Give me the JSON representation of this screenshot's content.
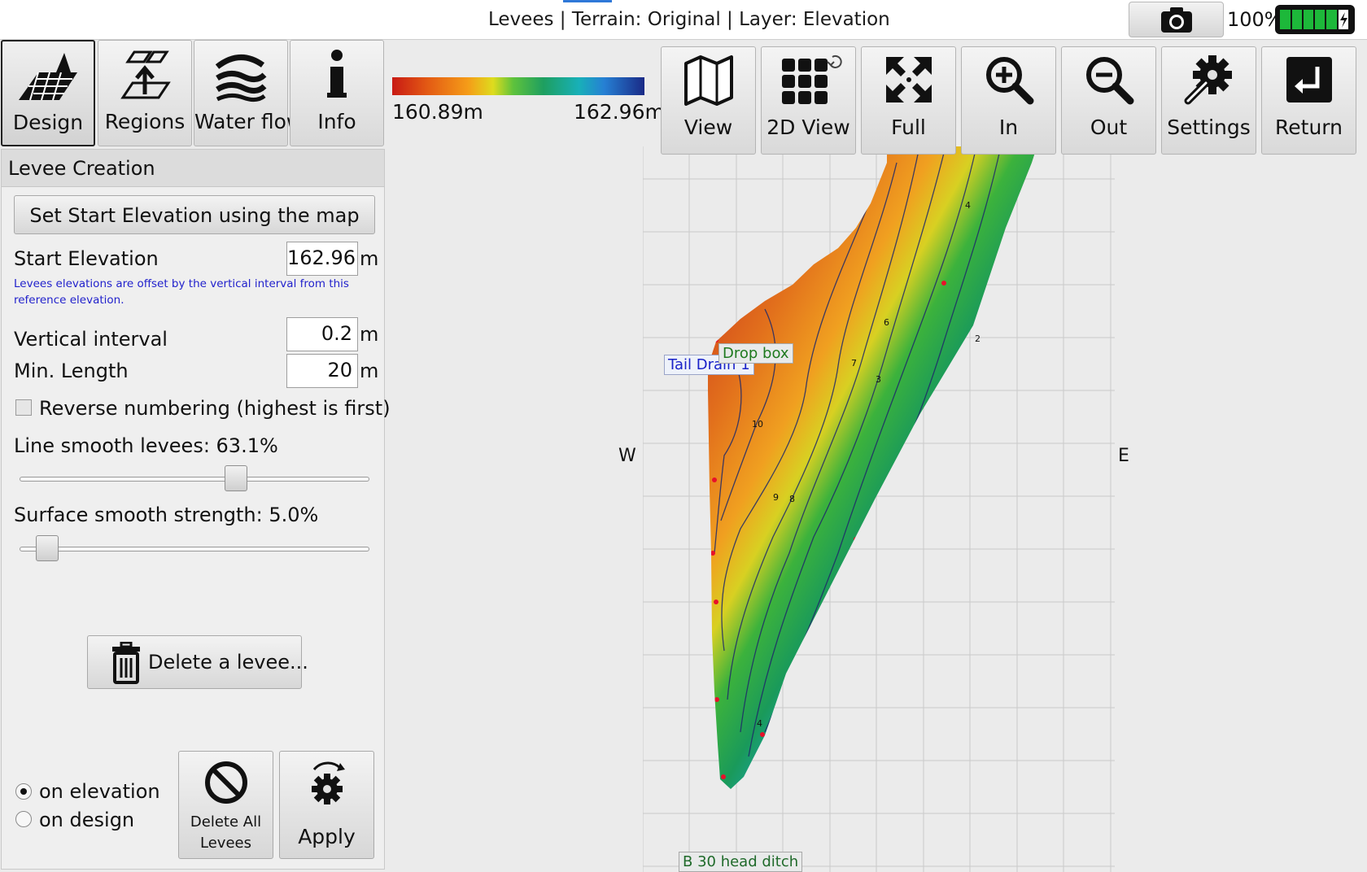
{
  "title_bar": {
    "title": "Levees | Terrain: Original | Layer: Elevation",
    "battery_percent": "100%"
  },
  "nav_tabs": [
    {
      "label": "Design",
      "icon": "field-design-icon",
      "active": true
    },
    {
      "label": "Regions",
      "icon": "regions-icon",
      "active": false
    },
    {
      "label": "Water flow",
      "icon": "water-flow-icon",
      "active": false
    },
    {
      "label": "Info",
      "icon": "info-icon",
      "active": false
    }
  ],
  "toolbar": [
    {
      "label": "View",
      "icon": "map-icon"
    },
    {
      "label": "2D View",
      "icon": "grid-2d-icon"
    },
    {
      "label": "Full",
      "icon": "full-extent-icon"
    },
    {
      "label": "In",
      "icon": "zoom-in-icon"
    },
    {
      "label": "Out",
      "icon": "zoom-out-icon"
    },
    {
      "label": "Settings",
      "icon": "settings-icon"
    },
    {
      "label": "Return",
      "icon": "return-icon"
    }
  ],
  "color_scale": {
    "min_label": "160.89m",
    "max_label": "162.96m"
  },
  "panel": {
    "title": "Levee Creation",
    "set_start_button": "Set Start Elevation using the map",
    "start_elevation_label": "Start Elevation",
    "start_elevation_value": "162.96",
    "unit": "m",
    "note": "Levees elevations are offset by the vertical interval from this reference elevation.",
    "vertical_interval_label": "Vertical interval",
    "vertical_interval_value": "0.2",
    "min_length_label": "Min. Length",
    "min_length_value": "20",
    "reverse_label": "Reverse numbering (highest is first)",
    "reverse_checked": false,
    "line_smooth_label": "Line smooth levees: 63.1%",
    "line_smooth_value": 0.631,
    "surface_smooth_label": "Surface smooth strength: 5.0%",
    "surface_smooth_value": 0.05,
    "delete_levee_button": "Delete a levee...",
    "radio_options": [
      "on elevation",
      "on design"
    ],
    "radio_selected": "on elevation",
    "delete_all_button": "Delete All Levees",
    "delete_all_line1": "Delete All",
    "delete_all_line2": "Levees",
    "apply_button": "Apply"
  },
  "map": {
    "compass_west": "W",
    "compass_east": "E",
    "labels": {
      "tail_drain": "Tail Drain 1",
      "drop_box": "Drop box",
      "head_ditch": "B 30 head ditch"
    },
    "contour_numbers": [
      "4",
      "2",
      "6",
      "7",
      "10",
      "9",
      "8",
      "3",
      "4"
    ]
  }
}
